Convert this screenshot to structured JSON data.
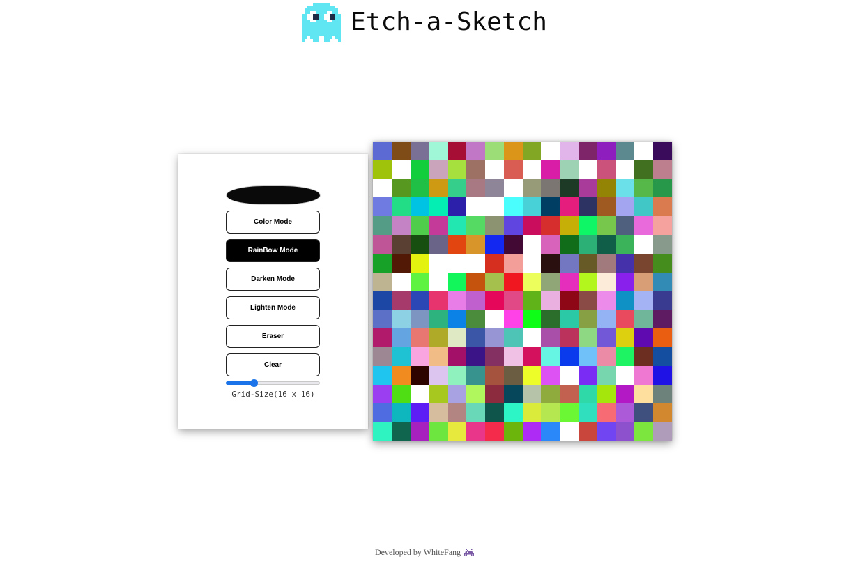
{
  "header": {
    "title": "Etch-a-Sketch",
    "logo_icon": "ghost-icon",
    "logo_color": "#5fe6f2"
  },
  "controls": {
    "color_picker": {
      "value": "#0a0a0a"
    },
    "buttons": [
      {
        "id": "color-mode",
        "label": "Color Mode",
        "active": false
      },
      {
        "id": "rainbow-mode",
        "label": "RainBow Mode",
        "active": true
      },
      {
        "id": "darken-mode",
        "label": "Darken Mode",
        "active": false
      },
      {
        "id": "lighten-mode",
        "label": "Lighten Mode",
        "active": false
      },
      {
        "id": "eraser",
        "label": "Eraser",
        "active": false
      },
      {
        "id": "clear",
        "label": "Clear",
        "active": false
      }
    ],
    "grid_size": {
      "min": 1,
      "max": 64,
      "value": 16,
      "label": "Grid-Size(16 x 16)"
    },
    "accent_color": "#1a73e8"
  },
  "grid": {
    "rows": 16,
    "cols": 16,
    "cells": [
      [
        "#5b6bd3",
        "#7f4b17",
        "#7a6f94",
        "#9ff7d8",
        "#a60e35",
        "#c176c6",
        "#9ddd78",
        "#db9519",
        "#82a725",
        "#ffffff",
        "#e2b5ea",
        "#7e2569",
        "#8e1fbe",
        "#5c8890",
        "#ffffff",
        "#3a0b5a"
      ],
      [
        "#9fc20a",
        "#ffffff",
        "#12cd3c",
        "#c9a4bb",
        "#a5e03e",
        "#9d7265",
        "#ffffff",
        "#da5d54",
        "#ffffff",
        "#d91da7",
        "#9dd3b4",
        "#ffffff",
        "#cb527a",
        "#ffffff",
        "#407020",
        "#bd7e8d"
      ],
      [
        "#ffffff",
        "#579920",
        "#20bf46",
        "#cf9a13",
        "#35cf8b",
        "#a87983",
        "#8e8698",
        "#ffffff",
        "#989b77",
        "#7c7672",
        "#1d3a27",
        "#a93c9b",
        "#938405",
        "#6ce0e8",
        "#57b84a",
        "#27974a"
      ],
      [
        "#6f7be0",
        "#22dd86",
        "#00c3e3",
        "#04eeb4",
        "#2c1fa9",
        "#ffffff",
        "#ffffff",
        "#49fefd",
        "#48d1d6",
        "#003f63",
        "#e51d7d",
        "#2d3362",
        "#9e5a20",
        "#a3a5f0",
        "#41c7c6",
        "#d97a4f"
      ],
      [
        "#549c85",
        "#c383c5",
        "#4fcd4b",
        "#c43a98",
        "#22e7b0",
        "#55da64",
        "#8b9370",
        "#6045e0",
        "#cb0d5e",
        "#d52e2d",
        "#c6af06",
        "#0ef566",
        "#78c74d",
        "#4f5f7e",
        "#e96bdb",
        "#f5a29f"
      ],
      [
        "#bf5497",
        "#5a4033",
        "#174f11",
        "#6a6488",
        "#e34510",
        "#d8962a",
        "#1328f0",
        "#420935",
        "#ffffff",
        "#d863bb",
        "#116d1a",
        "#2cb075",
        "#105e47",
        "#3ab35b",
        "#ffffff",
        "#879a8b"
      ],
      [
        "#18a129",
        "#521a06",
        "#e4f20f",
        "#ffffff",
        "#ffffff",
        "#ffffff",
        "#d62f1f",
        "#f49e9a",
        "#ffffff",
        "#2a100f",
        "#7377c1",
        "#675a27",
        "#a07a7c",
        "#4532ab",
        "#79452f",
        "#458e1d"
      ],
      [
        "#bfb492",
        "#ffffff",
        "#5ff341",
        "#ffffff",
        "#12f65c",
        "#c5530e",
        "#a5c04c",
        "#f11720",
        "#ecfe5b",
        "#91a676",
        "#e62ebd",
        "#b3f61e",
        "#fbebd8",
        "#8a20ec",
        "#d89e76",
        "#318bb4"
      ],
      [
        "#1d47a5",
        "#a53a6b",
        "#2a47b5",
        "#e8346e",
        "#e97de8",
        "#c060cf",
        "#e4075a",
        "#e04985",
        "#61b31a",
        "#eab0e0",
        "#8e0717",
        "#8a4a45",
        "#ec8be9",
        "#0f91c5",
        "#a4b3f4",
        "#383b8f"
      ],
      [
        "#5d70c8",
        "#8dd2e4",
        "#7d95c1",
        "#2db47e",
        "#0b82e6",
        "#4a8c3c",
        "#ffffff",
        "#fe42e7",
        "#0ffe18",
        "#2b6d2a",
        "#2bc9a6",
        "#87a044",
        "#93b3f5",
        "#ea4a5e",
        "#6fb69a",
        "#5e1b62"
      ],
      [
        "#b1196a",
        "#63a4e1",
        "#e97771",
        "#afaa28",
        "#dfeac4",
        "#3c56a7",
        "#9895d5",
        "#4dc4b5",
        "#ffffff",
        "#a94fa9",
        "#bb325d",
        "#8fd883",
        "#7257d6",
        "#ddd00e",
        "#5f0ab0",
        "#e95e10"
      ],
      [
        "#9c8793",
        "#1ec2d3",
        "#f9a5df",
        "#f1bc85",
        "#a21068",
        "#3b1488",
        "#853062",
        "#f0c1e5",
        "#d4115c",
        "#66f4e3",
        "#0a3bed",
        "#70c0f9",
        "#ec8ba5",
        "#1ef363",
        "#6c2e20",
        "#144ea0"
      ],
      [
        "#20c5ef",
        "#f18b20",
        "#2e0401",
        "#dcc5ee",
        "#8ff2be",
        "#37938e",
        "#a5523e",
        "#6b5d42",
        "#ecfd29",
        "#dc52f2",
        "#ffffff",
        "#7a2bf4",
        "#78d6af",
        "#ffffff",
        "#ef78d3",
        "#1e12e5"
      ],
      [
        "#9b3ef2",
        "#4fdd13",
        "#ffffff",
        "#a7c81e",
        "#a8a2e2",
        "#aff75d",
        "#8c2a3e",
        "#07475c",
        "#b6c3a8",
        "#8fab3d",
        "#c26150",
        "#2fd9a8",
        "#a5e60d",
        "#b31ac6",
        "#fedf9d",
        "#6d827b"
      ],
      [
        "#4f6de0",
        "#0db7bd",
        "#5d1df5",
        "#d5bd9e",
        "#b28583",
        "#68d8b8",
        "#10554b",
        "#2ef5c6",
        "#dbeb3c",
        "#b5e750",
        "#6cf734",
        "#30dfbe",
        "#f66b74",
        "#ad5ad8",
        "#3f507f",
        "#d2882e"
      ],
      [
        "#30f3c2",
        "#10654f",
        "#a621be",
        "#6de63f",
        "#e7ea3c",
        "#e9358a",
        "#f42b4a",
        "#6bb50d",
        "#ae2bf6",
        "#2b88f8",
        "#ffffff",
        "#c8463c",
        "#7146f2",
        "#8e51cd",
        "#7ce63e",
        "#af9cbb"
      ]
    ]
  },
  "footer": {
    "text": "Developed by WhiteFang",
    "icon": "alien-icon"
  }
}
